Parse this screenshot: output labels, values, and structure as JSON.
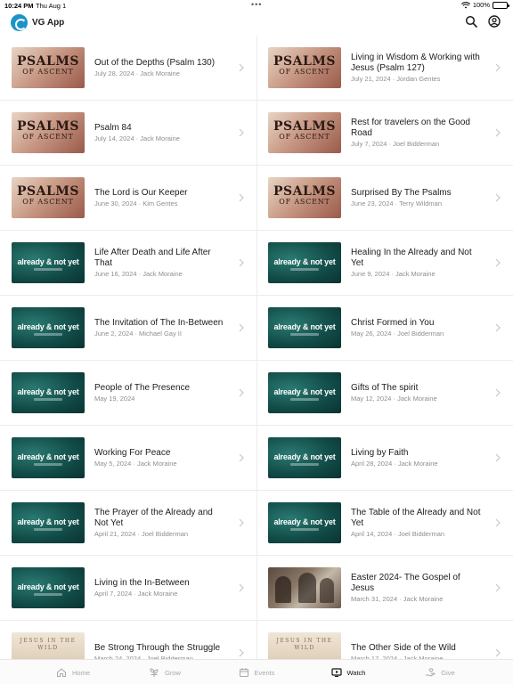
{
  "status_bar": {
    "time": "10:24 PM",
    "date": "Thu Aug 1",
    "battery": "100%"
  },
  "header": {
    "app_title": "VG App"
  },
  "items": [
    {
      "title": "Out of the Depths (Psalm 130)",
      "meta": "July 28, 2024 · Jack Moraine",
      "thumb": "psalms"
    },
    {
      "title": "Living in Wisdom & Working with Jesus (Psalm 127)",
      "meta": "July 21, 2024 · Jordan Gentes",
      "thumb": "psalms"
    },
    {
      "title": "Psalm 84",
      "meta": "July 14, 2024 · Jack Moraine",
      "thumb": "psalms"
    },
    {
      "title": "Rest for travelers on the Good Road",
      "meta": "July 7, 2024 · Joel Bidderman",
      "thumb": "psalms"
    },
    {
      "title": "The Lord is Our Keeper",
      "meta": "June 30, 2024 · Kim Gentes",
      "thumb": "psalms"
    },
    {
      "title": "Surprised By The Psalms",
      "meta": "June 23, 2024 · Terry Wildman",
      "thumb": "psalms"
    },
    {
      "title": "Life After Death and Life After That",
      "meta": "June 16, 2024 · Jack Moraine",
      "thumb": "already"
    },
    {
      "title": "Healing In the Already and Not Yet",
      "meta": "June 9, 2024 · Jack Moraine",
      "thumb": "already"
    },
    {
      "title": "The Invitation of The In-Between",
      "meta": "June 2, 2024 · Michael Gay II",
      "thumb": "already"
    },
    {
      "title": "Christ Formed in You",
      "meta": "May 26, 2024 · Joel Bidderman",
      "thumb": "already"
    },
    {
      "title": "People of The Presence",
      "meta": "May 19, 2024",
      "thumb": "already"
    },
    {
      "title": "Gifts of The spirit",
      "meta": "May 12, 2024 · Jack Moraine",
      "thumb": "already"
    },
    {
      "title": "Working For Peace",
      "meta": "May 5, 2024 · Jack Moraine",
      "thumb": "already"
    },
    {
      "title": "Living by Faith",
      "meta": "April 28, 2024 · Jack Moraine",
      "thumb": "already"
    },
    {
      "title": "The Prayer of the Already and Not Yet",
      "meta": "April 21, 2024 · Joel Bidderman",
      "thumb": "already"
    },
    {
      "title": "The Table of the Already and Not Yet",
      "meta": "April 14, 2024 · Joel Bidderman",
      "thumb": "already"
    },
    {
      "title": "Living in the In-Between",
      "meta": "April 7, 2024 · Jack Moraine",
      "thumb": "already"
    },
    {
      "title": "Easter 2024- The Gospel of Jesus",
      "meta": "March 31, 2024 · Jack Moraine",
      "thumb": "photo"
    },
    {
      "title": "Be Strong Through the Struggle",
      "meta": "March 24, 2024 · Joel Bidderman",
      "thumb": "jesus"
    },
    {
      "title": "The Other Side of the Wild",
      "meta": "March 17, 2024 · Jack Moraine",
      "thumb": "jesus"
    }
  ],
  "thumb_text": {
    "psalms_line1": "PSALMS",
    "psalms_line2": "OF ASCENT",
    "already": "already & not yet",
    "jesus": "JESUS IN THE WILD"
  },
  "tabs": [
    {
      "label": "Home",
      "icon": "home-icon",
      "active": false
    },
    {
      "label": "Grow",
      "icon": "sprout-icon",
      "active": false
    },
    {
      "label": "Events",
      "icon": "calendar-icon",
      "active": false
    },
    {
      "label": "Watch",
      "icon": "tv-icon",
      "active": true
    },
    {
      "label": "Give",
      "icon": "give-hand-icon",
      "active": false
    }
  ],
  "colors": {
    "accent": "#1c93c8",
    "teal_thumb": "#114a46",
    "active_tab": "#111111",
    "inactive_tab": "#a8a8ad"
  }
}
